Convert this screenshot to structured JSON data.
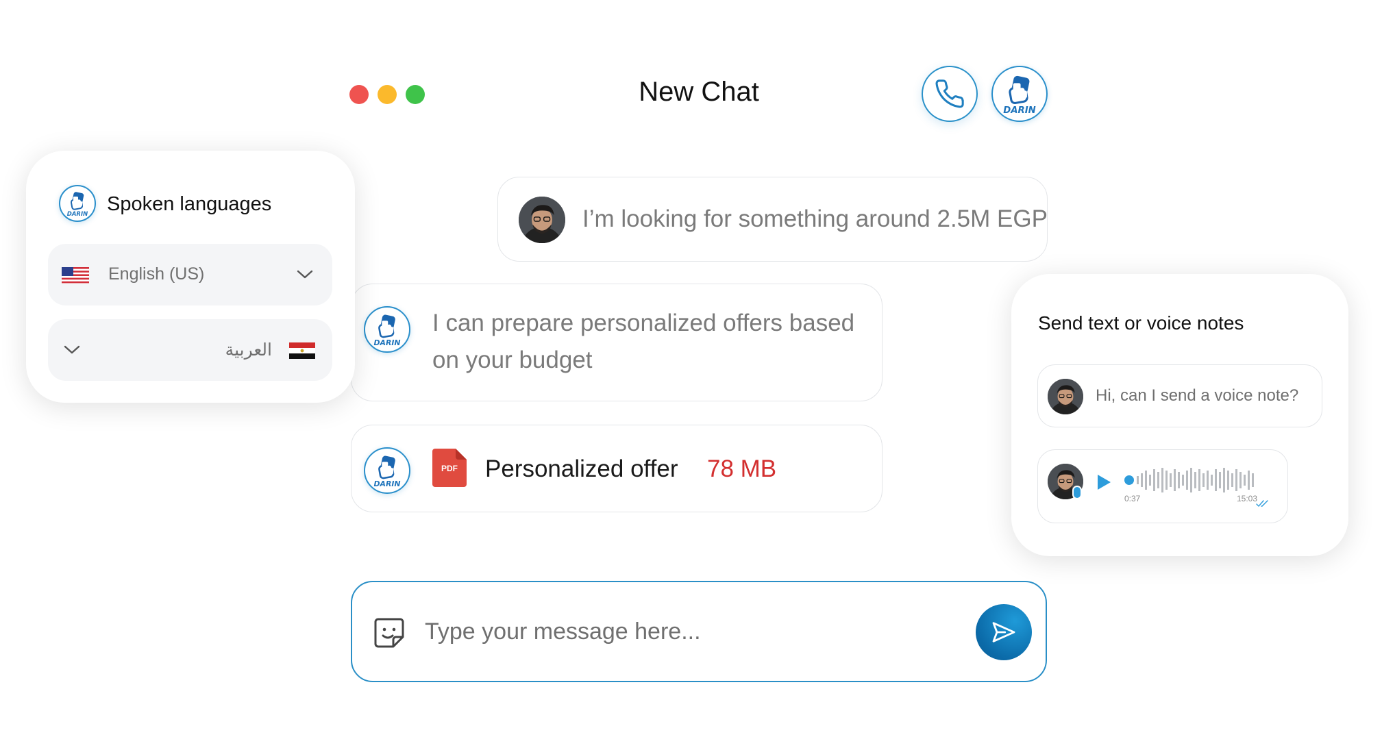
{
  "header": {
    "title": "New Chat"
  },
  "brand": {
    "logo_text": "DARIN",
    "accent": "#2a8fcb",
    "send_color": "#0b6aa8",
    "file_size_color": "#d32f2f"
  },
  "messages": [
    {
      "sender": "user",
      "text": "I’m looking for something around 2.5M EGP"
    },
    {
      "sender": "agent",
      "text_line1": "I can prepare personalized offers based",
      "text_line2": "on your budget"
    },
    {
      "sender": "agent",
      "file_label": "Personalized offer",
      "file_size": "78 MB",
      "file_icon_label": "PDF"
    }
  ],
  "languages_card": {
    "title": "Spoken languages",
    "selected": "English (US)",
    "second": "العربية"
  },
  "voice_card": {
    "title": "Send text or voice notes",
    "text_message": "Hi, can I send a voice note?",
    "voice_elapsed": "0:37",
    "voice_time": "15:03"
  },
  "composer": {
    "placeholder": "Type your message here..."
  },
  "icons": [
    "phone-icon",
    "darin-logo-icon",
    "sticker-icon",
    "send-icon",
    "chevron-down-icon",
    "us-flag-icon",
    "egypt-flag-icon",
    "pdf-file-icon",
    "play-icon",
    "mic-icon",
    "double-check-icon"
  ]
}
